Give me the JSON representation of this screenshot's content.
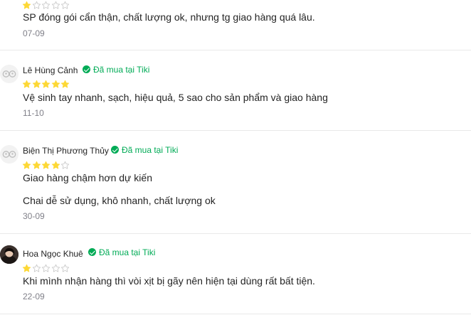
{
  "reviews": [
    {
      "rating": 1,
      "text": "SP đóng gói cẩn thận, chất lượng ok, nhưng tg giao hàng quá lâu.",
      "date": "07-09"
    },
    {
      "name": "Lê Hùng Cảnh",
      "verified": "Đã mua tại Tiki",
      "rating": 5,
      "text": "Vệ sinh tay nhanh, sạch, hiệu quả, 5 sao cho sản phẩm và giao hàng",
      "date": "11-10"
    },
    {
      "name": "Biện Thị Phương Thủy",
      "verified": "Đã mua tại Tiki",
      "rating": 4,
      "text": "Giao hàng chậm hơn dự kiến",
      "text2": "Chai dễ sử dụng, khô nhanh, chất lượng ok",
      "date": "30-09"
    },
    {
      "name": "Hoa Ngọc Khuê",
      "verified": "Đã mua tại Tiki",
      "rating": 1,
      "text": "Khi mình nhận hàng thì vòi xịt bị gãy nên hiện tại dùng rất bất tiện.",
      "date": "22-09"
    }
  ],
  "colors": {
    "star_filled": "#fdd836",
    "star_outline": "#c7c7c7",
    "verified": "#00ab56",
    "date": "#808089"
  },
  "icons": {
    "verified": "check-circle-icon",
    "star": "star-icon",
    "avatar_default": "default-avatar-icon"
  }
}
